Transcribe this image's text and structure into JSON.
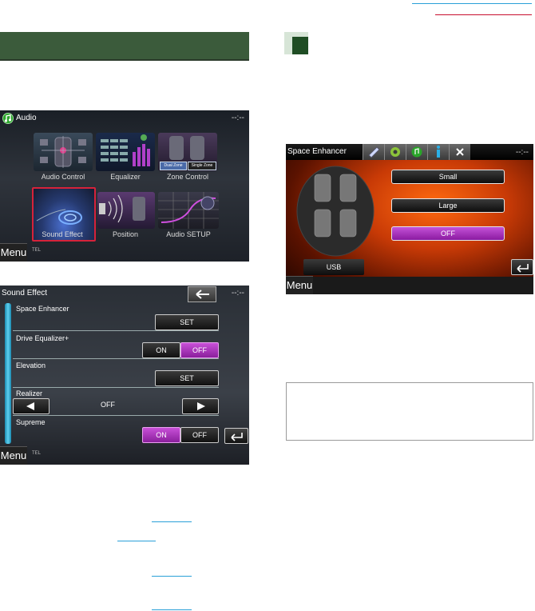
{
  "audio": {
    "title": "Audio",
    "clock": "--:--",
    "tiles": [
      {
        "label": "Audio Control"
      },
      {
        "label": "Equalizer"
      },
      {
        "label": "Zone Control",
        "zone_options": [
          "Dual Zone",
          "Single Zone"
        ]
      },
      {
        "label": "Sound Effect"
      },
      {
        "label": "Position"
      },
      {
        "label": "Audio SETUP"
      }
    ],
    "menu": "Menu",
    "tel": "TEL"
  },
  "sound_effect": {
    "title": "Sound Effect",
    "clock": "--:--",
    "rows": [
      {
        "label": "Space Enhancer",
        "button": "SET"
      },
      {
        "label": "Drive Equalizer+",
        "on": "ON",
        "off": "OFF",
        "selected": "OFF"
      },
      {
        "label": "Elevation",
        "button": "SET"
      },
      {
        "label": "Realizer",
        "value": "OFF"
      },
      {
        "label": "Supreme",
        "on": "ON",
        "off": "OFF",
        "selected": "ON"
      }
    ],
    "menu": "Menu",
    "tel": "TEL"
  },
  "space_enhancer": {
    "title": "Space Enhancer",
    "clock": "--:--",
    "options": [
      "Small",
      "Large",
      "OFF"
    ],
    "selected": "OFF",
    "source": "USB",
    "menu": "Menu"
  },
  "colors": {
    "header_bar": "#3b5b3b",
    "accent_purple": "#a030b8",
    "link_blue": "#2aa0d8",
    "link_red": "#c8102e"
  }
}
